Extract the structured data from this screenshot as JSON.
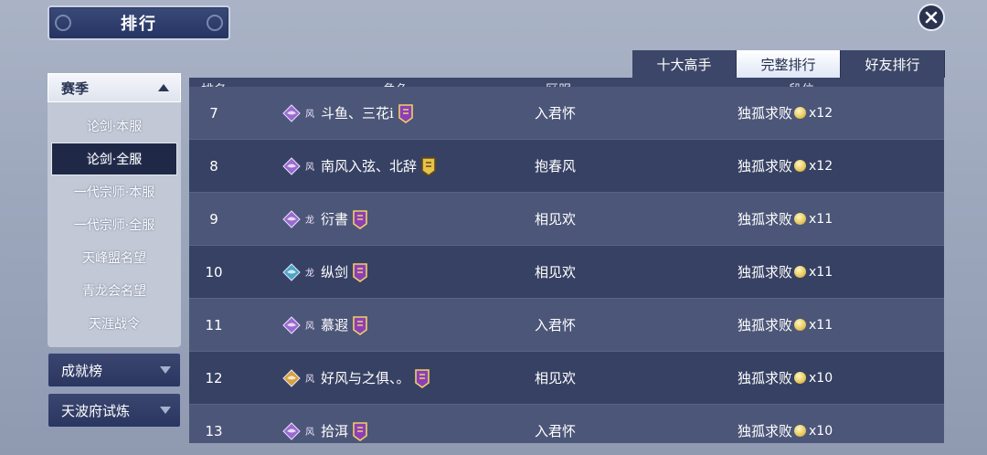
{
  "header": {
    "title": "排行"
  },
  "tabs": [
    {
      "label": "十大高手",
      "active": false
    },
    {
      "label": "完整排行",
      "active": true
    },
    {
      "label": "好友排行",
      "active": false
    }
  ],
  "sidebar": {
    "season": {
      "label": "赛季"
    },
    "sub_items": [
      {
        "label": "论剑·本服",
        "active": false
      },
      {
        "label": "论剑·全服",
        "active": true
      },
      {
        "label": "一代宗师·本服",
        "active": false
      },
      {
        "label": "一代宗师·全服",
        "active": false
      },
      {
        "label": "天峰盟名望",
        "active": false
      },
      {
        "label": "青龙会名望",
        "active": false
      },
      {
        "label": "天涯战令",
        "active": false
      }
    ],
    "categories": [
      {
        "label": "成就榜"
      },
      {
        "label": "天波府试炼"
      }
    ]
  },
  "table": {
    "headers": {
      "rank": "排名",
      "role": "角色",
      "server": "区服",
      "tier": "段位"
    },
    "rows": [
      {
        "rank": "7",
        "mark": "风",
        "name": "斗鱼、三花i",
        "server": "入君怀",
        "tier": "独孤求败",
        "count": "x12",
        "sect_color": "#9a6ad0",
        "badge": "purple"
      },
      {
        "rank": "8",
        "mark": "风",
        "name": "南风入弦、北辞",
        "server": "抱春风",
        "tier": "独孤求败",
        "count": "x12",
        "sect_color": "#9a6ad0",
        "badge": "gold"
      },
      {
        "rank": "9",
        "mark": "龙",
        "name": "衍書",
        "server": "相见欢",
        "tier": "独孤求败",
        "count": "x11",
        "sect_color": "#9a6ad0",
        "badge": "purple"
      },
      {
        "rank": "10",
        "mark": "龙",
        "name": "纵剑",
        "server": "相见欢",
        "tier": "独孤求败",
        "count": "x11",
        "sect_color": "#4aa6c8",
        "badge": "purple"
      },
      {
        "rank": "11",
        "mark": "风",
        "name": "慕遐",
        "server": "入君怀",
        "tier": "独孤求败",
        "count": "x11",
        "sect_color": "#9a6ad0",
        "badge": "purple"
      },
      {
        "rank": "12",
        "mark": "风",
        "name": "好风与之俱、。",
        "server": "相见欢",
        "tier": "独孤求败",
        "count": "x10",
        "sect_color": "#d6a23c",
        "badge": "purple"
      },
      {
        "rank": "13",
        "mark": "风",
        "name": "拾洱",
        "server": "入君怀",
        "tier": "独孤求败",
        "count": "x10",
        "sect_color": "#9a6ad0",
        "badge": "purple"
      }
    ]
  }
}
